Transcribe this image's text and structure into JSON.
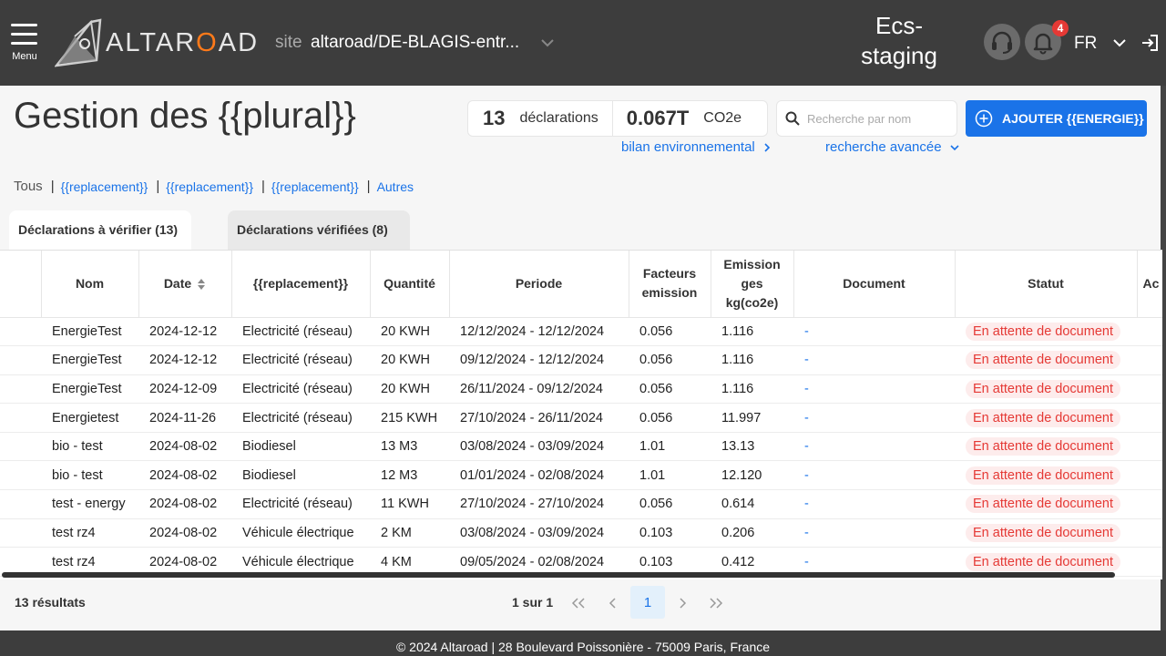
{
  "header": {
    "menu_label": "Menu",
    "logo_text_pre": "ALTAR",
    "logo_text_o": "O",
    "logo_text_post": "AD",
    "site_label": "site",
    "site_value": "altaroad/DE-BLAGIS-entr...",
    "env_label": "Ecs-staging",
    "notification_count": "4",
    "language": "FR"
  },
  "page": {
    "title": "Gestion des {{plural}}",
    "stats": {
      "count": "13",
      "count_label": "déclarations",
      "co2": "0.067T",
      "co2_label": "CO2e"
    },
    "search_placeholder": "Recherche par nom",
    "add_button": "AJOUTER {{ENERGIE}}",
    "bilan_link": "bilan environnemental",
    "advanced_search": "recherche avancée"
  },
  "filters": {
    "all": "Tous",
    "items": [
      "{{replacement}}",
      "{{replacement}}",
      "{{replacement}}",
      "Autres"
    ]
  },
  "tabs": [
    {
      "label": "Déclarations à vérifier (13)",
      "active": true
    },
    {
      "label": "Déclarations vérifiées (8)",
      "active": false
    }
  ],
  "table": {
    "columns": [
      "Nom",
      "Date",
      "{{replacement}}",
      "Quantité",
      "Periode",
      "Facteurs emission",
      "Emission ges kg(co2e)",
      "Document",
      "Statut",
      "Ac"
    ],
    "rows": [
      [
        "EnergieTest",
        "2024-12-12",
        "Electricité (réseau)",
        "20 KWH",
        "12/12/2024 - 12/12/2024",
        "0.056",
        "1.116",
        "-",
        "En attente de document"
      ],
      [
        "EnergieTest",
        "2024-12-12",
        "Electricité (réseau)",
        "20 KWH",
        "09/12/2024 - 12/12/2024",
        "0.056",
        "1.116",
        "-",
        "En attente de document"
      ],
      [
        "EnergieTest",
        "2024-12-09",
        "Electricité (réseau)",
        "20 KWH",
        "26/11/2024 - 09/12/2024",
        "0.056",
        "1.116",
        "-",
        "En attente de document"
      ],
      [
        "Energietest",
        "2024-11-26",
        "Electricité (réseau)",
        "215 KWH",
        "27/10/2024 - 26/11/2024",
        "0.056",
        "11.997",
        "-",
        "En attente de document"
      ],
      [
        "bio - test",
        "2024-08-02",
        "Biodiesel",
        "13 M3",
        "03/08/2024 - 03/09/2024",
        "1.01",
        "13.13",
        "-",
        "En attente de document"
      ],
      [
        "bio - test",
        "2024-08-02",
        "Biodiesel",
        "12 M3",
        "01/01/2024 - 02/08/2024",
        "1.01",
        "12.120",
        "-",
        "En attente de document"
      ],
      [
        "test - energy",
        "2024-08-02",
        "Electricité (réseau)",
        "11 KWH",
        "27/10/2024 - 27/10/2024",
        "0.056",
        "0.614",
        "-",
        "En attente de document"
      ],
      [
        "test rz4",
        "2024-08-02",
        "Véhicule électrique",
        "2 KM",
        "03/08/2024 - 03/09/2024",
        "0.103",
        "0.206",
        "-",
        "En attente de document"
      ],
      [
        "test rz4",
        "2024-08-02",
        "Véhicule électrique",
        "4 KM",
        "09/05/2024 - 02/08/2024",
        "0.103",
        "0.412",
        "-",
        "En attente de document"
      ]
    ]
  },
  "pagination": {
    "results": "13 résultats",
    "page_info": "1 sur 1",
    "current_page": "1"
  },
  "footer": {
    "text": "© 2024 Altaroad | 28 Boulevard Poissonière - 75009 Paris, France"
  },
  "colors": {
    "header_bg": "#3d3d3d",
    "accent": "#1a73e8",
    "status_red": "#e53935",
    "logo_orange": "#ff7a1a"
  }
}
